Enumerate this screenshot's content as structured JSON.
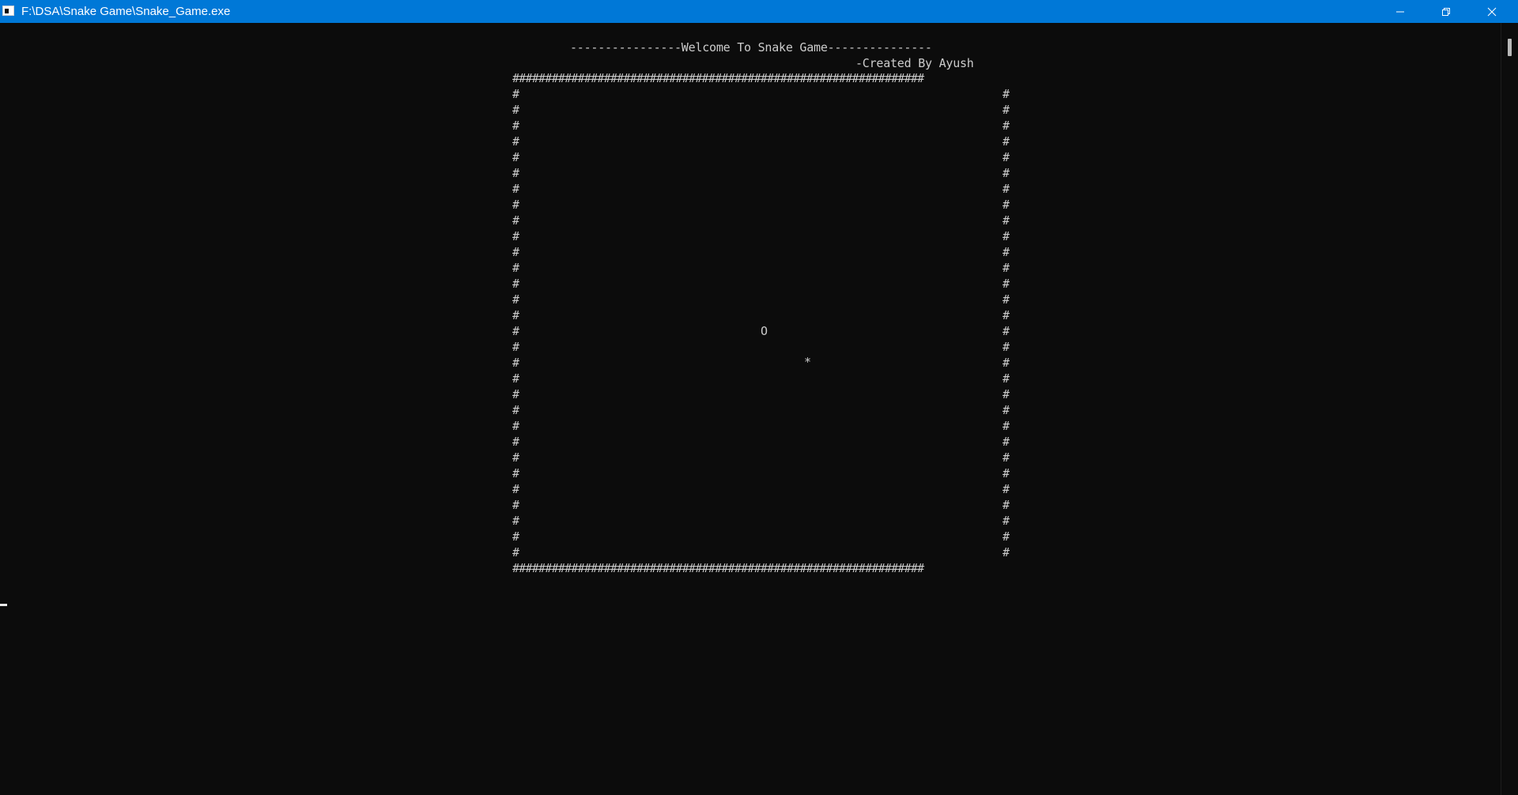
{
  "window": {
    "title": "F:\\DSA\\Snake Game\\Snake_Game.exe",
    "titlebar_color": "#0078d7",
    "background_color": "#0c0c0c",
    "text_color": "#cccccc",
    "controls": [
      "minimize-icon",
      "restore-icon",
      "close-icon"
    ]
  },
  "console": {
    "header_line": "----------------Welcome To Snake Game---------------",
    "credit_line": "-Created By Ayush"
  },
  "game": {
    "wall_char": "#",
    "wall_top": "###############################################################",
    "wall_bottom": "###############################################################",
    "inner_rows": 30,
    "snake_head": "O",
    "fruit": "*"
  }
}
